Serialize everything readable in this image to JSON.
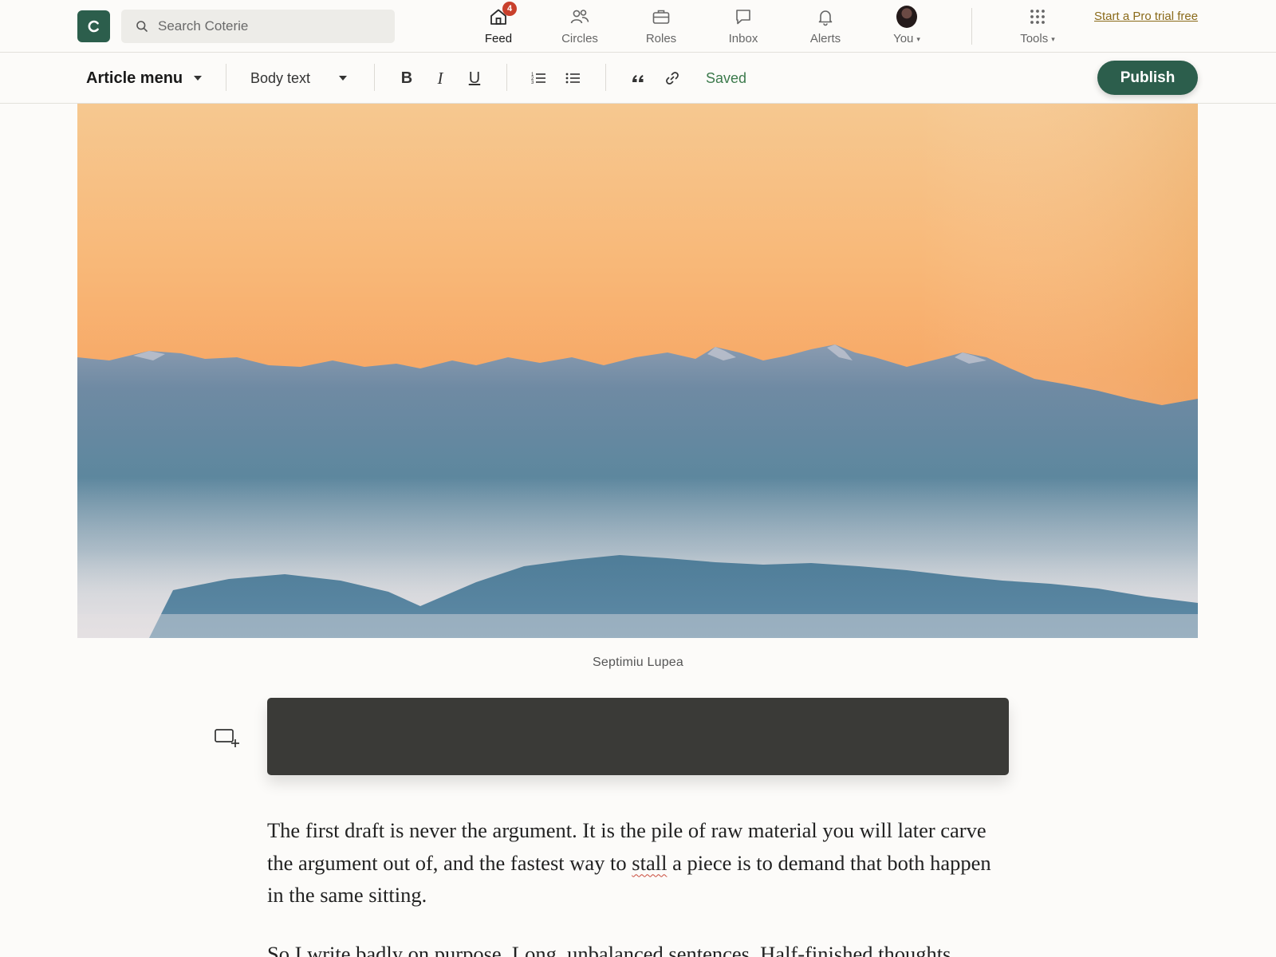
{
  "app": {
    "logo_letter": "C",
    "brand_color": "#2c5e4c"
  },
  "search": {
    "placeholder": "Search Coterie",
    "value": ""
  },
  "nav": {
    "items": [
      {
        "label": "Feed",
        "icon": "home-icon",
        "badge": "4",
        "active": true
      },
      {
        "label": "Circles",
        "icon": "people-icon"
      },
      {
        "label": "Roles",
        "icon": "briefcase-icon"
      },
      {
        "label": "Inbox",
        "icon": "chat-icon"
      },
      {
        "label": "Alerts",
        "icon": "bell-icon"
      },
      {
        "label": "You",
        "icon": "avatar",
        "dropdown": true
      }
    ],
    "tools": {
      "label": "Tools",
      "icon": "grid-icon",
      "dropdown": true
    },
    "pro_trial": "Start a Pro trial free"
  },
  "toolbar": {
    "article_menu": "Article menu",
    "text_style": "Body text",
    "bold": "B",
    "italic": "I",
    "underline": "U",
    "quote": "“",
    "status": "Saved",
    "publish": "Publish"
  },
  "article": {
    "image_credit": "Septimiu Lupea",
    "paragraph_1": {
      "before": "The first draft is never the argument. It is the pile of raw material you will later carve the argument out of, and the fastest way to ",
      "flagged_word": "stall",
      "after": " a piece is to demand that both happen in the same sitting."
    },
    "paragraph_2": "So I write badly on purpose. Long, unbalanced sentences. Half-finished thoughts."
  },
  "colors": {
    "accent": "#2c5e4c",
    "saved": "#3c7a4c",
    "badge": "#c9402c",
    "pro_link": "#8a6a1a"
  }
}
